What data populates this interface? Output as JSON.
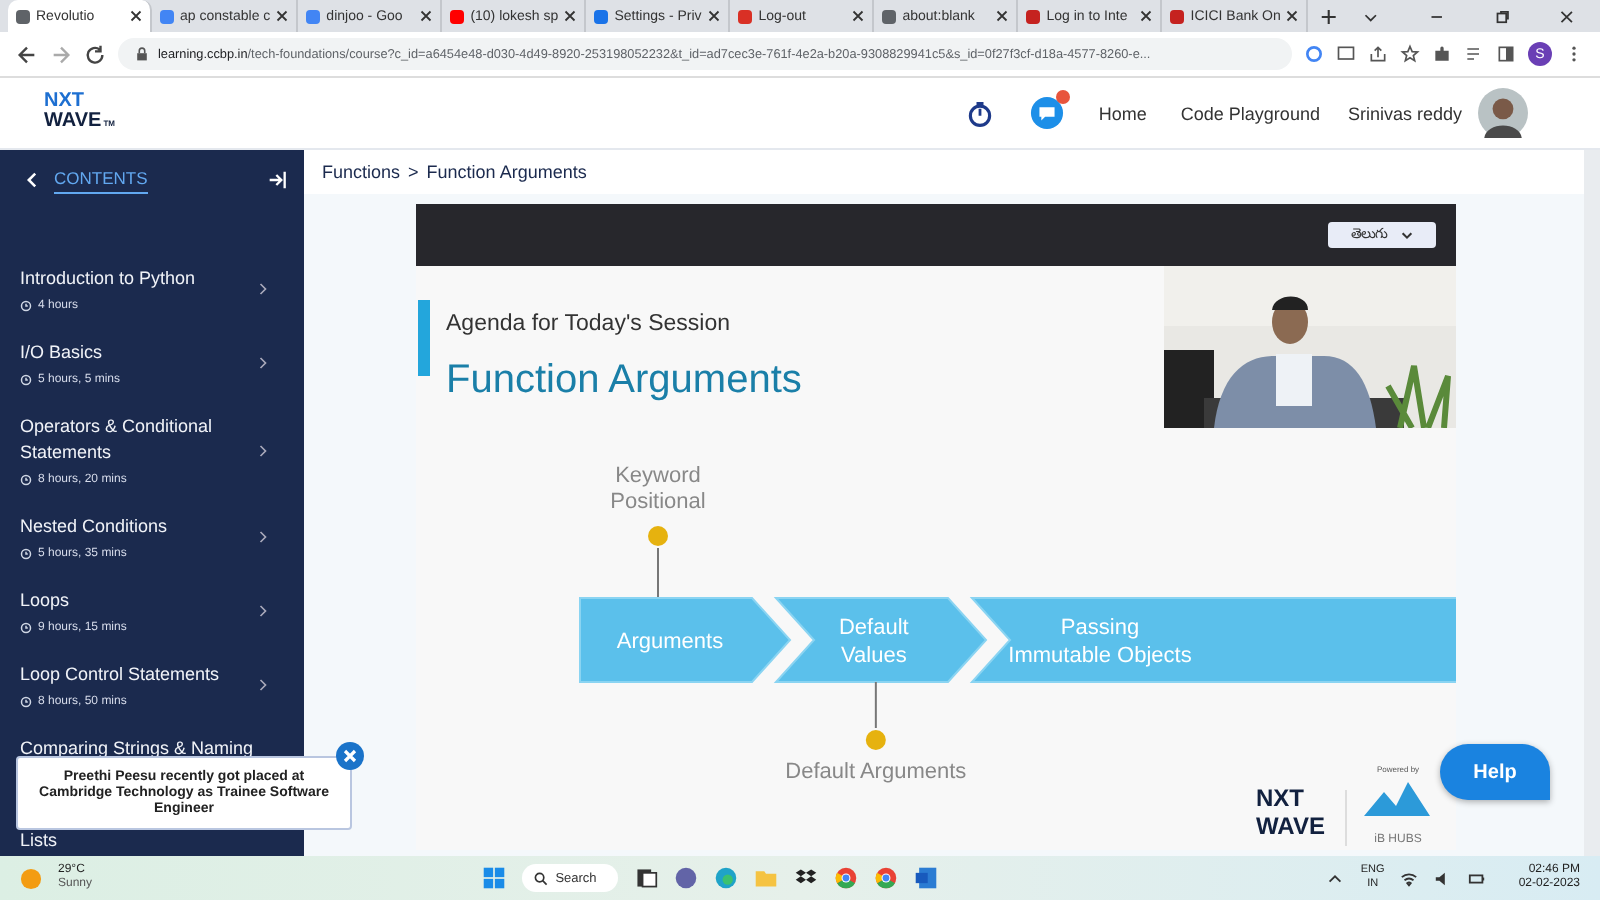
{
  "browser": {
    "tabs": [
      {
        "title": "Revolutio",
        "selected": true,
        "color": "#5f6368"
      },
      {
        "title": "ap constable c",
        "selected": false,
        "color": "#4285f4"
      },
      {
        "title": "dinjoo - Goo",
        "selected": false,
        "color": "#4285f4"
      },
      {
        "title": "(10) lokesh sp",
        "selected": false,
        "color": "#ff0000"
      },
      {
        "title": "Settings - Priv",
        "selected": false,
        "color": "#1a73e8"
      },
      {
        "title": "Log-out",
        "selected": false,
        "color": "#d93025"
      },
      {
        "title": "about:blank",
        "selected": false,
        "color": "#5f6368"
      },
      {
        "title": "Log in to Inte",
        "selected": false,
        "color": "#c5221f"
      },
      {
        "title": "ICICI Bank On",
        "selected": false,
        "color": "#c5221f"
      }
    ],
    "url_domain": "learning.ccbp.in",
    "url_path": "/tech-foundations/course?c_id=a6454e48-d030-4d49-8920-253198052232&t_id=ad7cec3e-761f-4e2a-b20a-9308829941c5&s_id=0f27f3cf-d18a-4577-8260-e...",
    "profile_initial": "S"
  },
  "header": {
    "logo": [
      "NXT",
      "WAVE"
    ],
    "logo_tm": "TM",
    "nav": [
      "Home",
      "Code Playground"
    ],
    "user": "Srinivas reddy"
  },
  "sidebar": {
    "title": "CONTENTS",
    "items": [
      {
        "title": "Introduction to Python",
        "duration": "4 hours"
      },
      {
        "title": "I/O Basics",
        "duration": "5 hours, 5 mins"
      },
      {
        "title": "Operators & Conditional Statements",
        "duration": "8 hours, 20 mins"
      },
      {
        "title": "Nested Conditions",
        "duration": "5 hours, 35 mins"
      },
      {
        "title": "Loops",
        "duration": "9 hours, 15 mins"
      },
      {
        "title": "Loop Control Statements",
        "duration": "8 hours, 50 mins"
      },
      {
        "title": "Comparing Strings & Naming"
      },
      {
        "title": "Lists"
      }
    ]
  },
  "breadcrumb": {
    "items": [
      "Functions",
      "Function Arguments"
    ],
    "separator": ">"
  },
  "video": {
    "language": "తెలుగు",
    "slide": {
      "subtitle": "Agenda for Today's Session",
      "title": "Function Arguments",
      "steps": [
        {
          "lines": [
            "Arguments"
          ],
          "notes_above": [
            "Keyword",
            "Positional"
          ]
        },
        {
          "lines": [
            "Default",
            "Values"
          ],
          "notes_below": [
            "Default Arguments"
          ]
        },
        {
          "lines": [
            "Passing",
            "Immutable Objects"
          ]
        }
      ],
      "logo": [
        "NXT",
        "WAVE"
      ],
      "powered_by": "Powered by",
      "partner": "iB HUBS"
    }
  },
  "toast": {
    "message": "Preethi Peesu recently got placed at Cambridge Technology as Trainee Software Engineer"
  },
  "help_button": "Help",
  "taskbar": {
    "temperature": "29°C",
    "weather": "Sunny",
    "search": "Search",
    "language": [
      "ENG",
      "IN"
    ],
    "time": "02:46 PM",
    "date": "02-02-2023"
  }
}
